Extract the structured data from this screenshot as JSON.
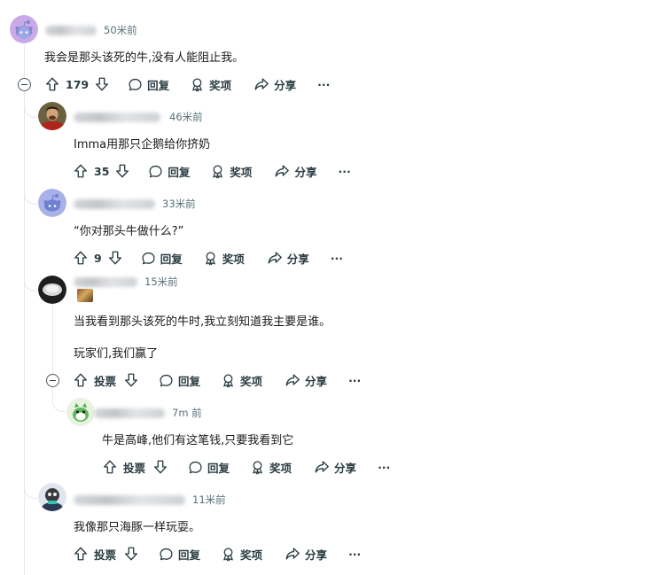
{
  "comments": [
    {
      "author_blurred": true,
      "time": "50米前",
      "text": "我会是那头该死的牛,没有人能阻止我。",
      "actions": {
        "votes": "179",
        "reply": "回复",
        "award": "奖项",
        "share": "分享",
        "more": "···"
      }
    },
    {
      "author_blurred": true,
      "time": "46米前",
      "text": "Imma用那只企鹅给你挤奶",
      "actions": {
        "votes": "35",
        "reply": "回复",
        "award": "奖项",
        "share": "分享",
        "more": "···"
      }
    },
    {
      "author_blurred": true,
      "time": "33米前",
      "text": "“你对那头牛做什么?”",
      "actions": {
        "votes": "9",
        "reply": "回复",
        "award": "奖项",
        "share": "分享",
        "more": "···"
      }
    },
    {
      "author_blurred": true,
      "time": "15米前",
      "text": "当我看到那头该死的牛时,我立刻知道我主要是谁。",
      "text2": "玩家们,我们赢了",
      "actions": {
        "votes": "投票",
        "reply": "回复",
        "award": "奖项",
        "share": "分享",
        "more": "···"
      }
    },
    {
      "author_blurred": true,
      "time": "7m 前",
      "text": "牛是高峰,他们有这笔钱,只要我看到它",
      "actions": {
        "votes": "投票",
        "reply": "回复",
        "award": "奖项",
        "share": "分享",
        "more": "···"
      }
    },
    {
      "author_blurred": true,
      "time": "11米前",
      "text": "我像那只海豚一样玩耍。",
      "actions": {
        "votes": "投票",
        "reply": "回复",
        "award": "奖项",
        "share": "分享",
        "more": "···"
      }
    }
  ],
  "icons": {
    "upvote": "arrow-up-icon",
    "downvote": "arrow-down-icon",
    "reply": "speech-bubble-icon",
    "award": "award-ribbon-icon",
    "share": "share-arrow-icon",
    "collapse": "minus-circle-icon"
  },
  "colors": {
    "text": "#1a1a1b",
    "meta": "#576f76",
    "action": "#2a3c42",
    "thread": "#e5e8eb"
  }
}
